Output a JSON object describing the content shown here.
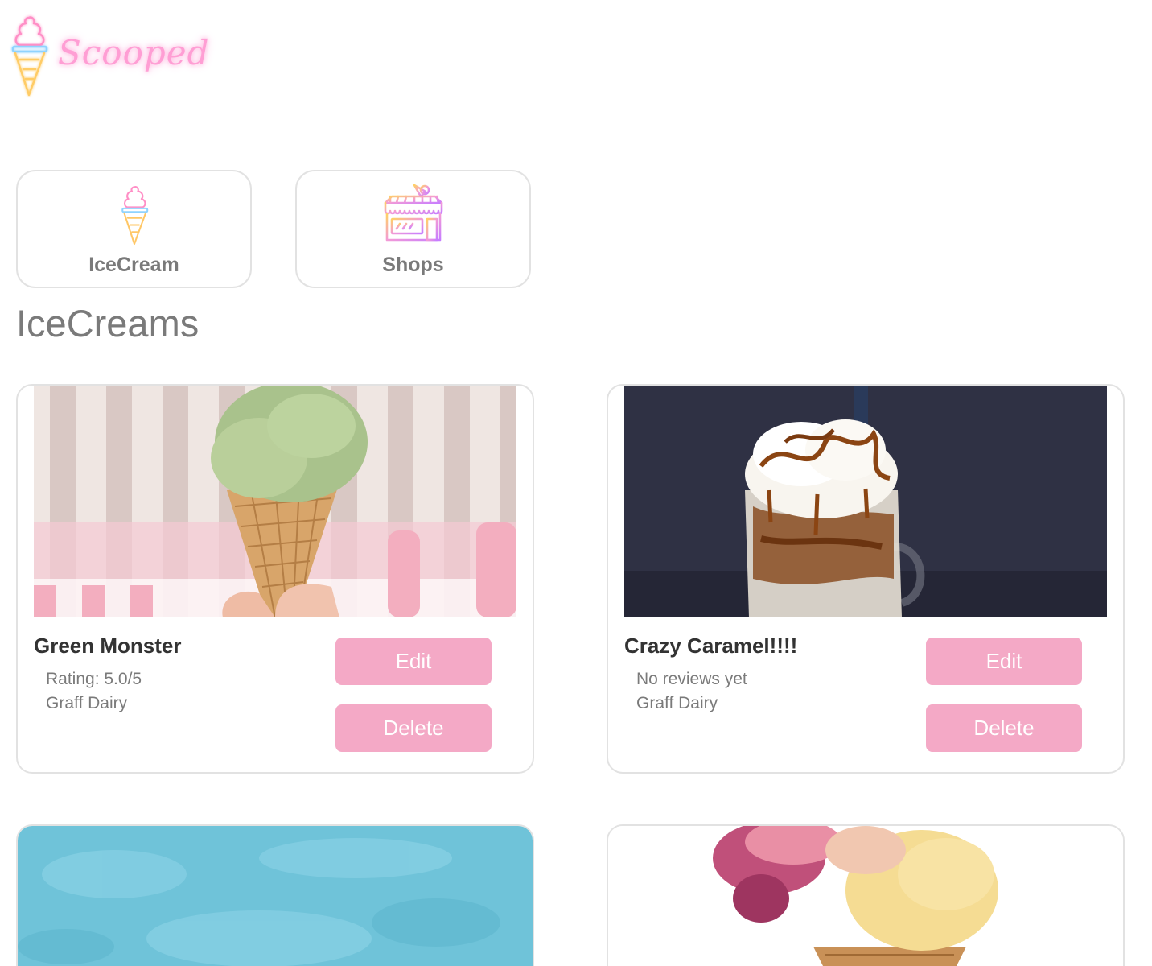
{
  "app": {
    "logo_text": "Scooped"
  },
  "nav": [
    {
      "label": "IceCream",
      "icon": "ice-cream-cone-icon"
    },
    {
      "label": "Shops",
      "icon": "shop-storefront-icon"
    }
  ],
  "section": {
    "title": "IceCreams"
  },
  "icecreams": [
    {
      "name": "Green Monster",
      "rating_text": "Rating: 5.0/5",
      "shop": "Graff Dairy",
      "edit_label": "Edit",
      "delete_label": "Delete",
      "image": "green-pistachio-cone-photo"
    },
    {
      "name": "Crazy Caramel!!!!",
      "rating_text": "No reviews yet",
      "shop": "Graff Dairy",
      "edit_label": "Edit",
      "delete_label": "Delete",
      "image": "caramel-sundae-jar-photo"
    },
    {
      "image": "blue-textured-background-photo"
    },
    {
      "image": "strawberry-vanilla-double-scoop-photo"
    }
  ],
  "colors": {
    "accent_pink": "#f4a9c6",
    "logo_neon_pink": "#ff9ed4",
    "border_gray": "#e2e2e2",
    "text_gray": "#7a7a7a",
    "title_dark": "#333333"
  }
}
